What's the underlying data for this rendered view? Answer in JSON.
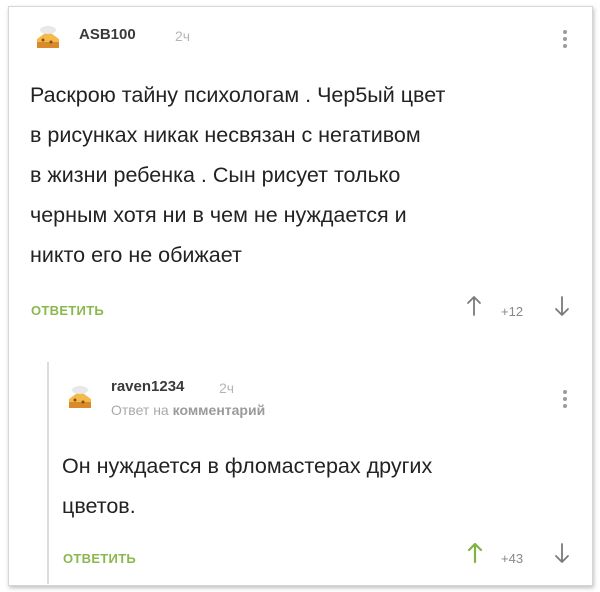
{
  "comment": {
    "username": "ASB100",
    "time": "2ч",
    "text_lines": [
      "Раскрою тайну психологам . Чер5ый цвет",
      "в рисунках никак несвязан с негативом",
      "в жизни ребенка . Сын рисует только",
      "черным хотя ни в чем не нуждается и",
      "никто его не обижает"
    ],
    "reply_label": "ОТВЕТИТЬ",
    "rating": "+12",
    "avatar_icon": "cake-avatar-icon",
    "menu_icon": "vertical-dots-icon",
    "upvote_icon": "arrow-up-icon",
    "downvote_icon": "arrow-down-icon"
  },
  "reply": {
    "username": "raven1234",
    "time": "2ч",
    "reply_to_prefix": "Ответ на",
    "reply_to_link": "комментарий",
    "text_lines": [
      "Он нуждается в фломастерах других",
      "цветов."
    ],
    "reply_label": "ОТВЕТИТЬ",
    "rating": "+43",
    "upvote_active": true
  },
  "colors": {
    "accent_green": "#8ab84d",
    "upvote_green": "#7fb342",
    "muted_gray": "#b5b5b5"
  }
}
